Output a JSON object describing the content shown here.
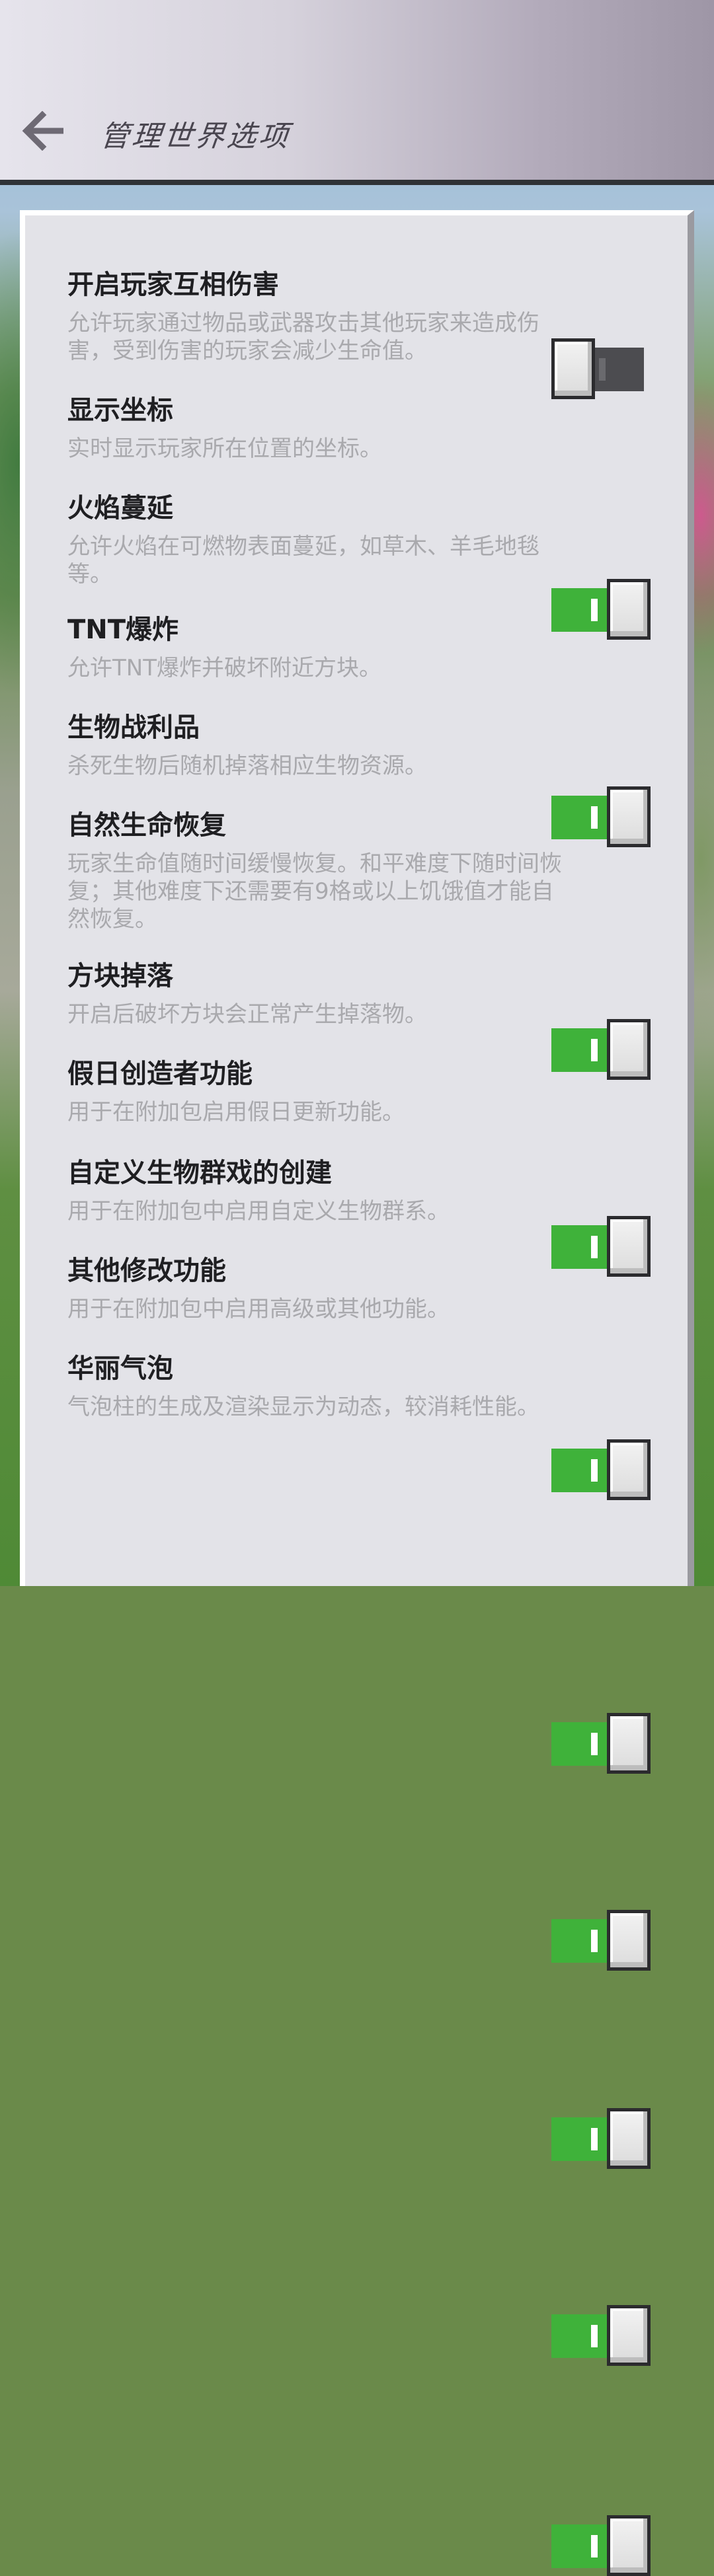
{
  "header": {
    "title": "管理世界选项",
    "back_icon": "arrow-left-icon"
  },
  "colors": {
    "toggle_on": "#3fb23a",
    "toggle_off": "#4c4c50",
    "panel_bg": "#e3e3e8"
  },
  "options": [
    {
      "label": "开启玩家互相伤害",
      "desc": "允许玩家通过物品或武器攻击其他玩家来造成伤害，受到伤害的玩家会减少生命值。",
      "enabled": false
    },
    {
      "label": "显示坐标",
      "desc": "实时显示玩家所在位置的坐标。",
      "enabled": true
    },
    {
      "label": "火焰蔓延",
      "desc": "允许火焰在可燃物表面蔓延，如草木、羊毛地毯等。",
      "enabled": true
    },
    {
      "label": "TNT爆炸",
      "desc": "允许TNT爆炸并破坏附近方块。",
      "enabled": true
    },
    {
      "label": "生物战利品",
      "desc": "杀死生物后随机掉落相应生物资源。",
      "enabled": true
    },
    {
      "label": "自然生命恢复",
      "desc": "玩家生命值随时间缓慢恢复。和平难度下随时间恢复；其他难度下还需要有9格或以上饥饿值才能自然恢复。",
      "enabled": true
    },
    {
      "label": "方块掉落",
      "desc": "开启后破坏方块会正常产生掉落物。",
      "enabled": true
    },
    {
      "label": "假日创造者功能",
      "desc": "用于在附加包启用假日更新功能。",
      "enabled": true
    },
    {
      "label": "自定义生物群戏的创建",
      "desc": "用于在附加包中启用自定义生物群系。",
      "enabled": true
    },
    {
      "label": "其他修改功能",
      "desc": "用于在附加包中启用高级或其他功能。",
      "enabled": true
    },
    {
      "label": "华丽气泡",
      "desc": "气泡柱的生成及渲染显示为动态，较消耗性能。",
      "enabled": true
    }
  ]
}
